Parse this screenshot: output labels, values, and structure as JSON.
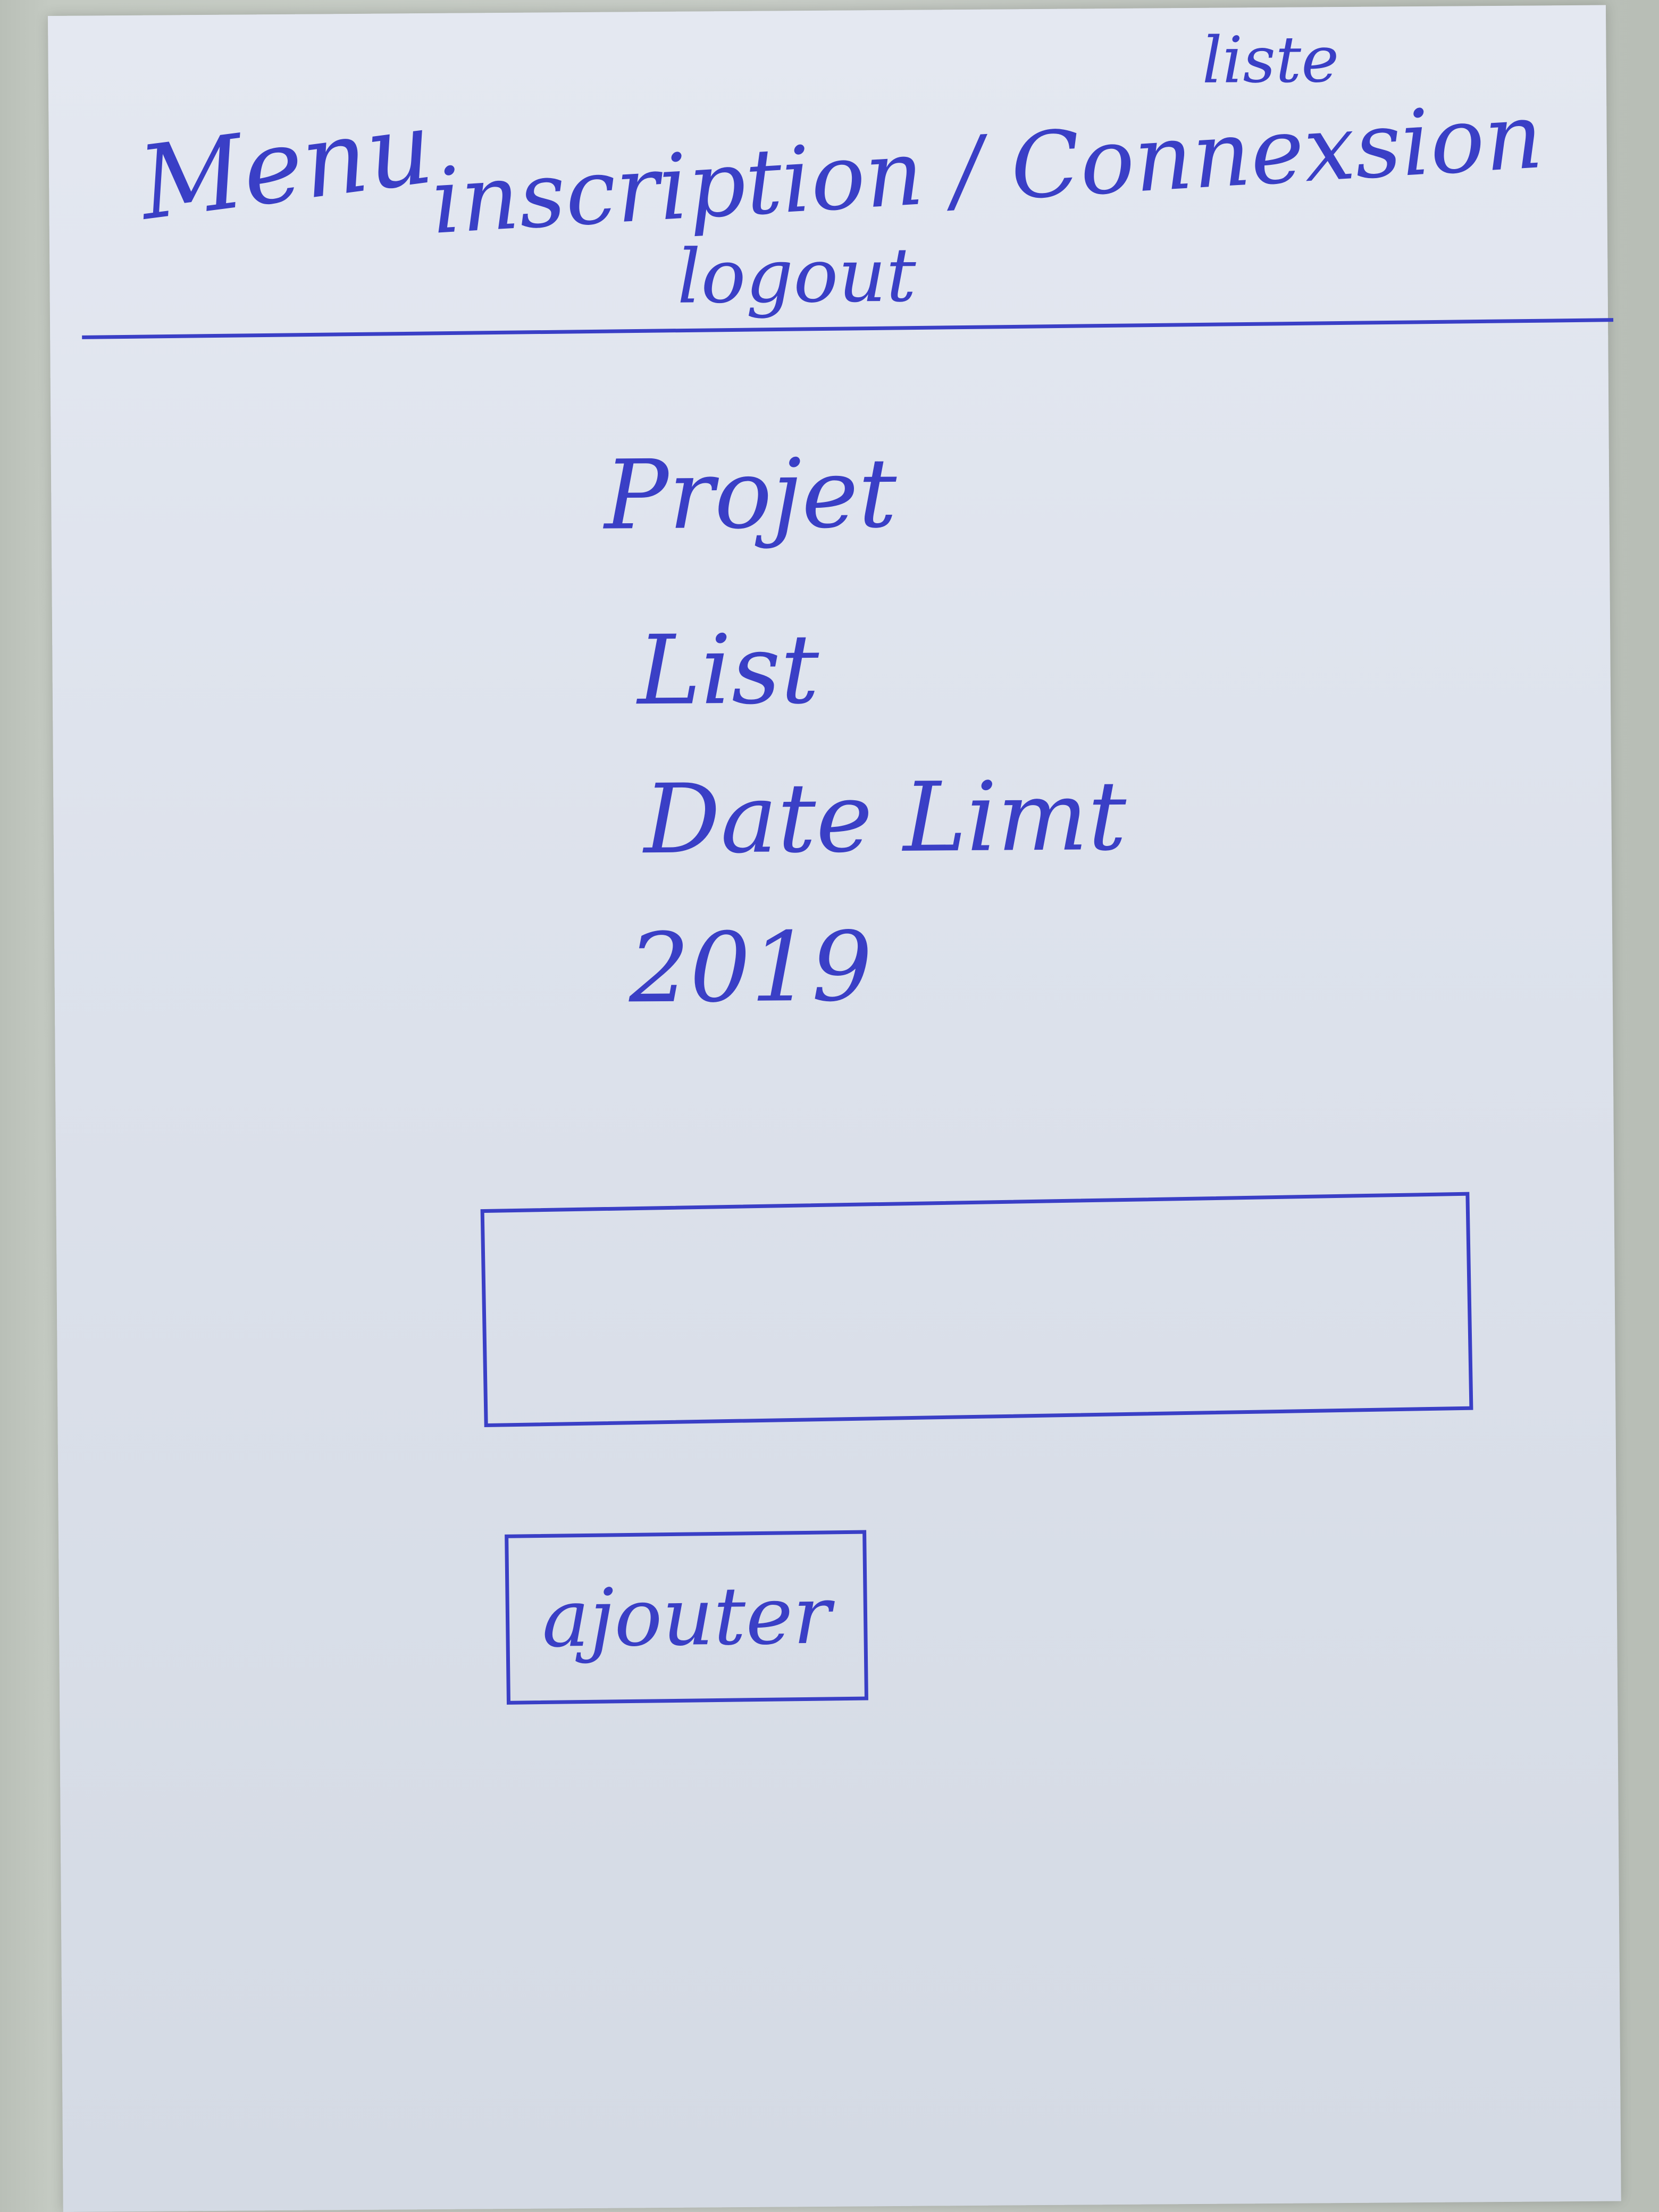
{
  "nav": {
    "menu_label": "Menu",
    "liste_label": "liste",
    "auth_label": "inscription / Connexsion",
    "logout_label": "logout"
  },
  "form": {
    "project_label": "Projet",
    "list_label": "List",
    "date_label": "Date Limt",
    "year_label": "2019",
    "input_value": "",
    "add_button_label": "ajouter"
  },
  "colors": {
    "ink": "#3a3fc6",
    "paper": "#dde2ec"
  }
}
